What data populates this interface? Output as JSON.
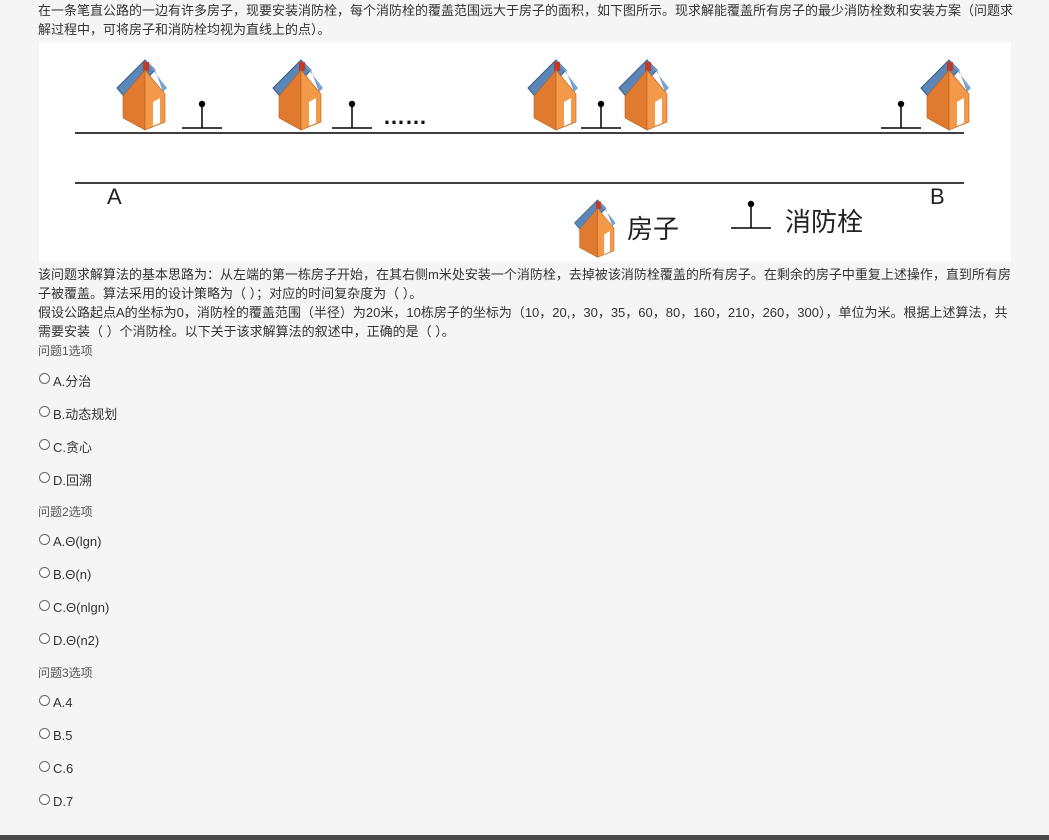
{
  "intro": "在一条笔直公路的一边有许多房子，现要安装消防栓，每个消防栓的覆盖范围远大于房子的面积，如下图所示。现求解能覆盖所有房子的最少消防栓数和安装方案（问题求解过程中，可将房子和消防栓均视为直线上的点）。",
  "figure": {
    "label_a": "A",
    "label_b": "B",
    "ellipsis": "……",
    "legend_house": "房子",
    "legend_hydrant": "消防栓"
  },
  "para1": "该问题求解算法的基本思路为：从左端的第一栋房子开始，在其右侧m米处安装一个消防栓，去掉被该消防栓覆盖的所有房子。在剩余的房子中重复上述操作，直到所有房子被覆盖。算法采用的设计策略为（ ）；对应的时间复杂度为（ ）。",
  "para2": "假设公路起点A的坐标为0，消防栓的覆盖范围（半径）为20米，10栋房子的坐标为（10，20,，30，35，60，80，160，210，260，300），单位为米。根据上述算法，共需要安装（ ）个消防栓。以下关于该求解算法的叙述中，正确的是（ ）。",
  "questions": [
    {
      "title": "问题1选项",
      "options": [
        "A.分治",
        "B.动态规划",
        "C.贪心",
        "D.回溯"
      ]
    },
    {
      "title": "问题2选项",
      "options": [
        "A.Θ(lgn)",
        "B.Θ(n)",
        "C.Θ(nlgn)",
        "D.Θ(n2)"
      ]
    },
    {
      "title": "问题3选项",
      "options": [
        "A.4",
        "B.5",
        "C.6",
        "D.7"
      ]
    }
  ]
}
